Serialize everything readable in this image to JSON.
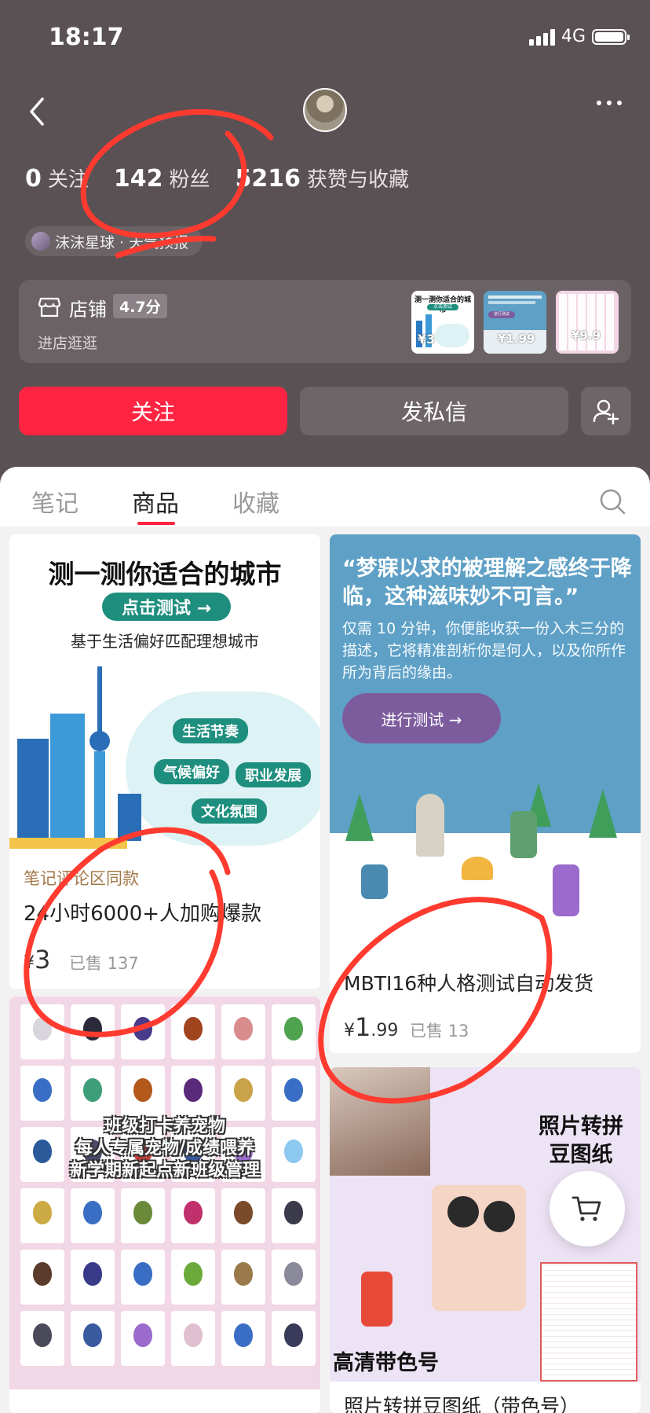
{
  "status_bar": {
    "time": "18:17",
    "network": "4G"
  },
  "profile": {
    "stats": [
      {
        "value": "0",
        "label": "关注"
      },
      {
        "value": "142",
        "label": "粉丝"
      },
      {
        "value": "5216",
        "label": "获赞与收藏"
      }
    ],
    "tag": "沫沫星球 · 天气预报"
  },
  "shop": {
    "label": "店铺",
    "score": "4.7分",
    "sub": "进店逛逛",
    "thumbs": [
      {
        "title": "测一测你适合的城市",
        "btn": "点击测试",
        "price": "¥3"
      },
      {
        "title": "进行测试",
        "price": "¥1.99"
      },
      {
        "price": "¥9.9"
      }
    ]
  },
  "actions": {
    "follow": "关注",
    "message": "发私信"
  },
  "tabs": [
    {
      "label": "笔记",
      "active": false
    },
    {
      "label": "商品",
      "active": true
    },
    {
      "label": "收藏",
      "active": false
    }
  ],
  "products": {
    "city": {
      "title": "测一测你适合的城市",
      "button": "点击测试 →",
      "subtitle": "基于生活偏好匹配理想城市",
      "pills": [
        "生活节奏",
        "气候偏好",
        "职业发展",
        "文化氛围"
      ],
      "tagline": "笔记评论区同款",
      "name": "24小时6000+人加购爆款",
      "price_symbol": "¥",
      "price_int": "3",
      "sold": "已售 137"
    },
    "mbti": {
      "quote": "“梦寐以求的被理解之感终于降临，这种滋味妙不可言。”",
      "desc": "仅需 10 分钟，你便能收获一份入木三分的描述，它将精准剖析你是何人，以及你所作所为背后的缘由。",
      "button": "进行测试  →",
      "name": "MBTI16种人格测试自动发货",
      "price_symbol": "¥",
      "price_int": "1",
      "price_dec": ".99",
      "sold": "已售 13"
    },
    "pet": {
      "lines": [
        "班级打卡养宠物",
        "每人专属宠物/成绩喂养",
        "新学期新起点新班级管理"
      ],
      "egg_colors": [
        "#d9d5dc",
        "#2a2a3a",
        "#4a3a8a",
        "#a0441e",
        "#d98c8c",
        "#4fa34f",
        "#3a6ec4",
        "#3f9e7a",
        "#b3591c",
        "#5a2a7a",
        "#c9a24a",
        "#3a6ec4",
        "#2a5a9a",
        "#4a4a6a",
        "#c0403a",
        "#3a5aa0",
        "#9a6acc",
        "#8cc8f0",
        "#ccaa44",
        "#3a6ec4",
        "#6a8a3a",
        "#c0306a",
        "#7a4a2a",
        "#3a3a4a",
        "#5a3a2a",
        "#3a3a8a",
        "#3a6ec4",
        "#6aaa3a",
        "#9a7a4a",
        "#8a8a9a",
        "#4a4a5a",
        "#3a5aa0",
        "#9a6acc",
        "#e0c0d0",
        "#3a6ec4",
        "#3a3a5a"
      ]
    },
    "photo": {
      "overlay_1": "照片转拼豆图纸",
      "overlay_2": "高清带色号",
      "name": "照片转拼豆图纸（带色号）"
    }
  },
  "colors": {
    "brand": "#ff2442",
    "header_bg": "#5a5155",
    "annotation": "#ff3b30"
  }
}
